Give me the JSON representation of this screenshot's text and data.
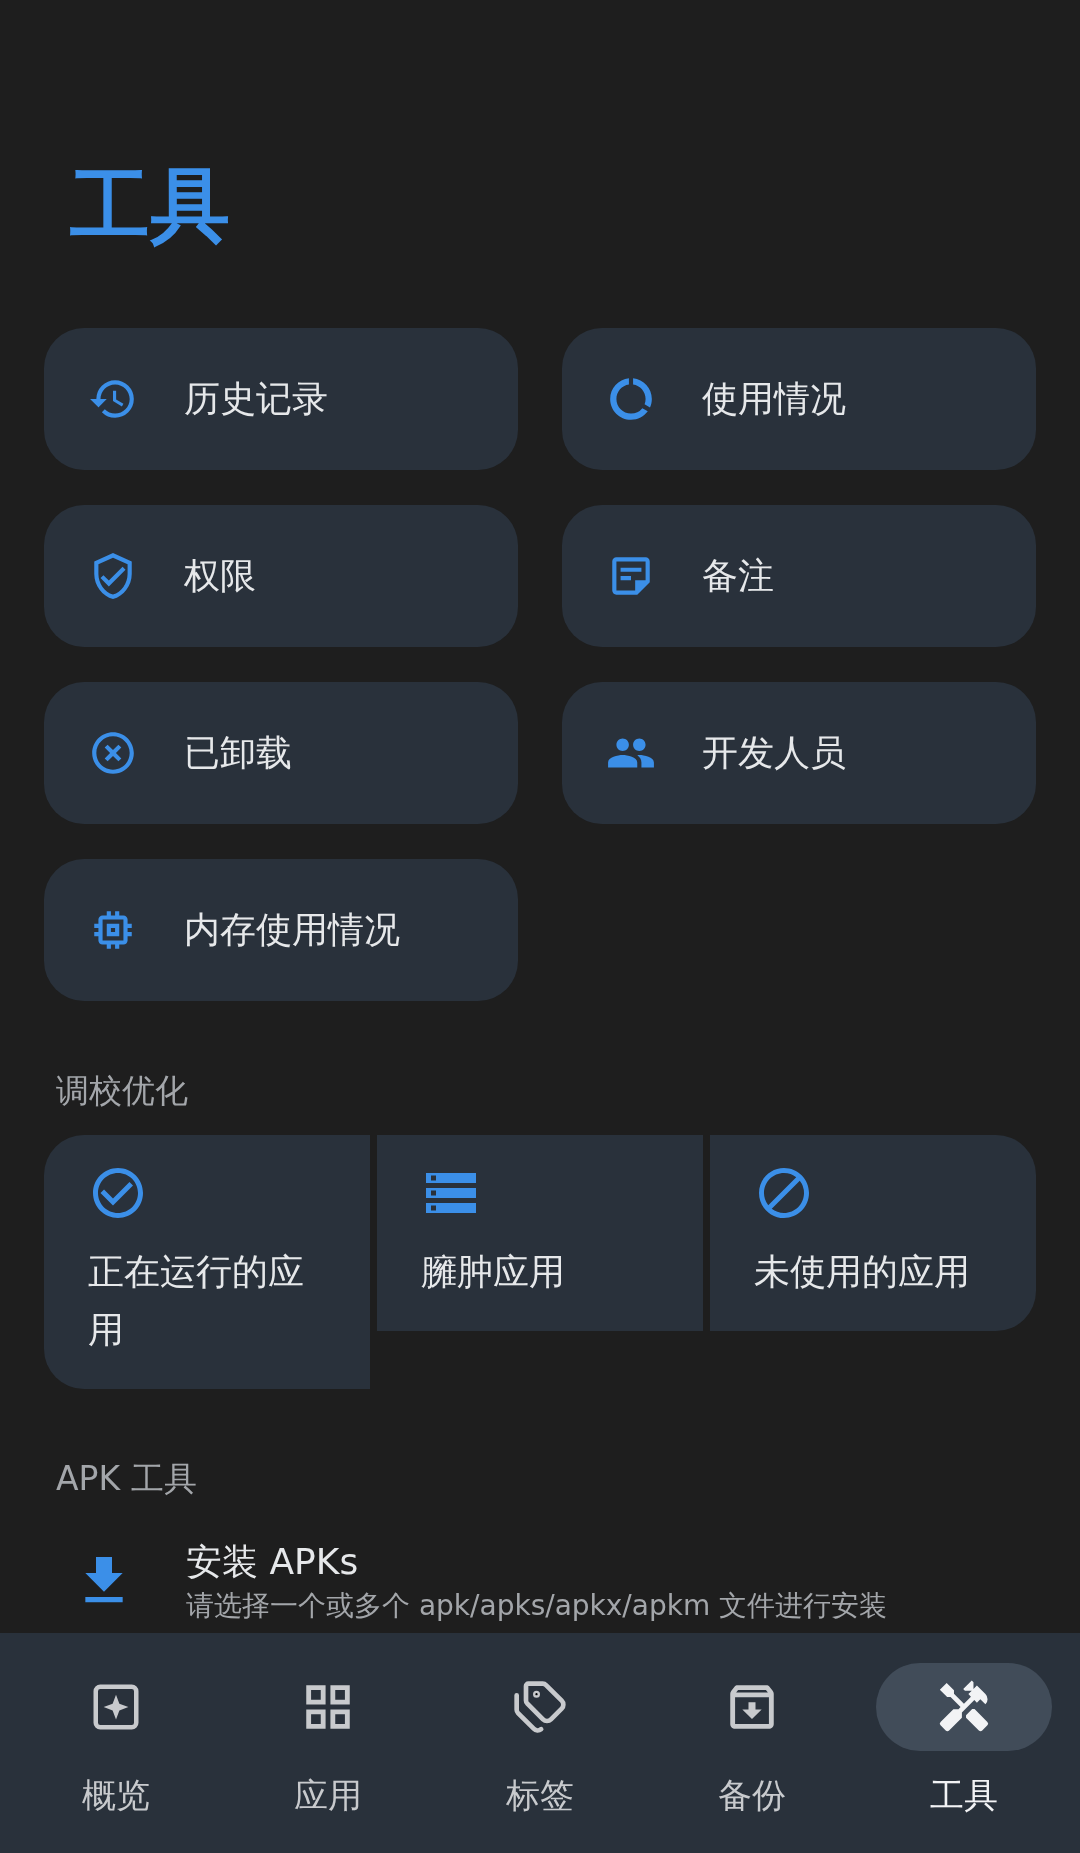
{
  "title": "工具",
  "tools": [
    "历史记录",
    "使用情况",
    "权限",
    "备注",
    "已卸载",
    "开发人员",
    "内存使用情况"
  ],
  "optimization": {
    "heading": "调校优化",
    "items": [
      "正在运行的应用",
      "臃肿应用",
      "未使用的应用"
    ]
  },
  "apk_tools": {
    "heading": "APK 工具",
    "items": [
      {
        "title": "安装 APKs",
        "subtitle": "请选择一个或多个 apk/apks/apkx/apkm 文件进行安装"
      }
    ]
  },
  "nav": [
    {
      "label": "概览",
      "selected": false
    },
    {
      "label": "应用",
      "selected": false
    },
    {
      "label": "标签",
      "selected": false
    },
    {
      "label": "备份",
      "selected": false
    },
    {
      "label": "工具",
      "selected": true
    }
  ]
}
